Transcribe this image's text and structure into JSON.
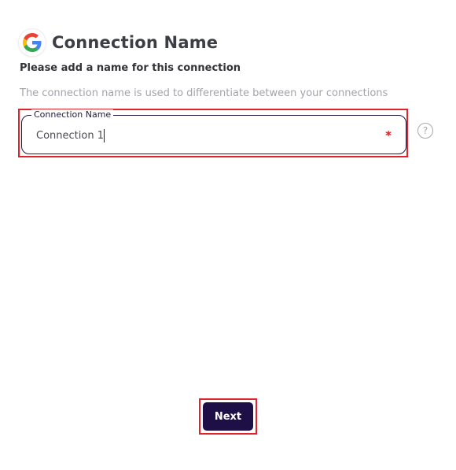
{
  "header": {
    "icon": "google-g-logo-icon",
    "title": "Connection Name"
  },
  "subtitle": "Please add a name for this connection",
  "description": "The connection name is used to differentiate between your connections",
  "connection_field": {
    "label": "Connection Name",
    "value": "Connection 1",
    "required_marker": "*",
    "help_icon": "help-circle-icon",
    "help_glyph": "?"
  },
  "footer": {
    "next_label": "Next"
  },
  "colors": {
    "highlight": "#e0222a",
    "primary": "#1e0f47",
    "required": "#d01c24"
  }
}
